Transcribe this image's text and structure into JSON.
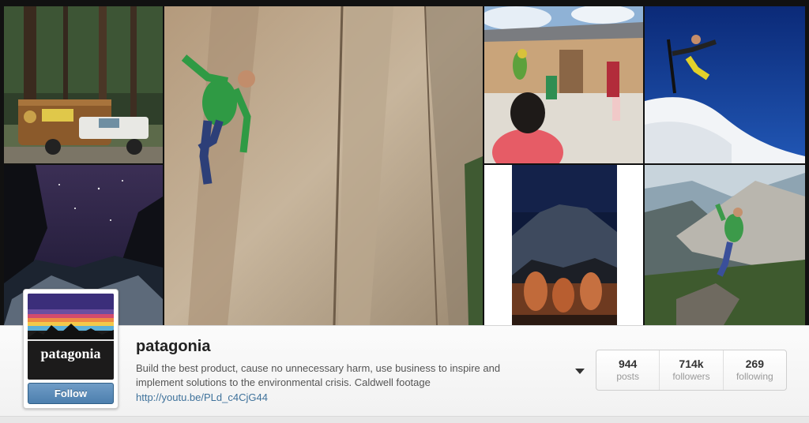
{
  "profile": {
    "username": "patagonia",
    "bio_lines": [
      "Build the best product, cause no unnecessary harm, use business to inspire and",
      "implement solutions to the environmental crisis. Caldwell footage"
    ],
    "link": "http://youtu.be/PLd_c4CjG44",
    "avatar_wordmark": "patagonia",
    "follow_label": "Follow"
  },
  "stats": [
    {
      "value": "944",
      "label": "posts"
    },
    {
      "value": "714k",
      "label": "followers"
    },
    {
      "value": "269",
      "label": "following"
    }
  ],
  "colors": {
    "follow_button": "#5a88b5",
    "link": "#3f729b",
    "avatar_bg": "#1c1b1b"
  },
  "icons": {
    "dropdown": "caret-down-icon"
  }
}
